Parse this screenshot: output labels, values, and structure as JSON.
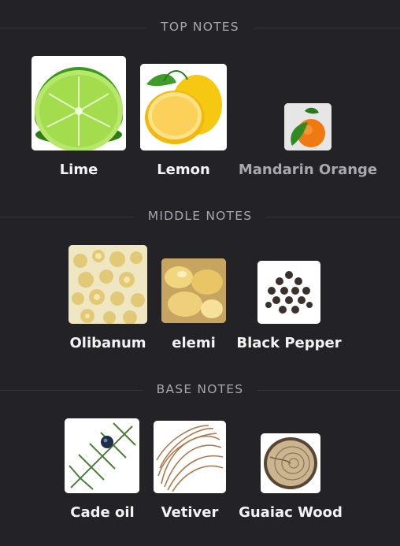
{
  "sections": {
    "top": {
      "title": "TOP NOTES",
      "notes": [
        {
          "name": "Lime",
          "icon": "lime-image"
        },
        {
          "name": "Lemon",
          "icon": "lemon-image"
        },
        {
          "name": "Mandarin Orange",
          "icon": "mandarin-orange-image"
        }
      ]
    },
    "middle": {
      "title": "MIDDLE NOTES",
      "notes": [
        {
          "name": "Olibanum",
          "icon": "olibanum-image"
        },
        {
          "name": "elemi",
          "icon": "elemi-image"
        },
        {
          "name": "Black Pepper",
          "icon": "black-pepper-image"
        }
      ]
    },
    "base": {
      "title": "BASE NOTES",
      "notes": [
        {
          "name": "Cade oil",
          "icon": "cade-oil-image"
        },
        {
          "name": "Vetiver",
          "icon": "vetiver-image"
        },
        {
          "name": "Guaiac Wood",
          "icon": "guaiac-wood-image"
        }
      ]
    }
  },
  "colors": {
    "background": "#232226",
    "divider": "#35343a",
    "section_title": "#a7a6b0",
    "label_primary": "#f3f3f3",
    "label_muted": "#a9a8b0"
  }
}
